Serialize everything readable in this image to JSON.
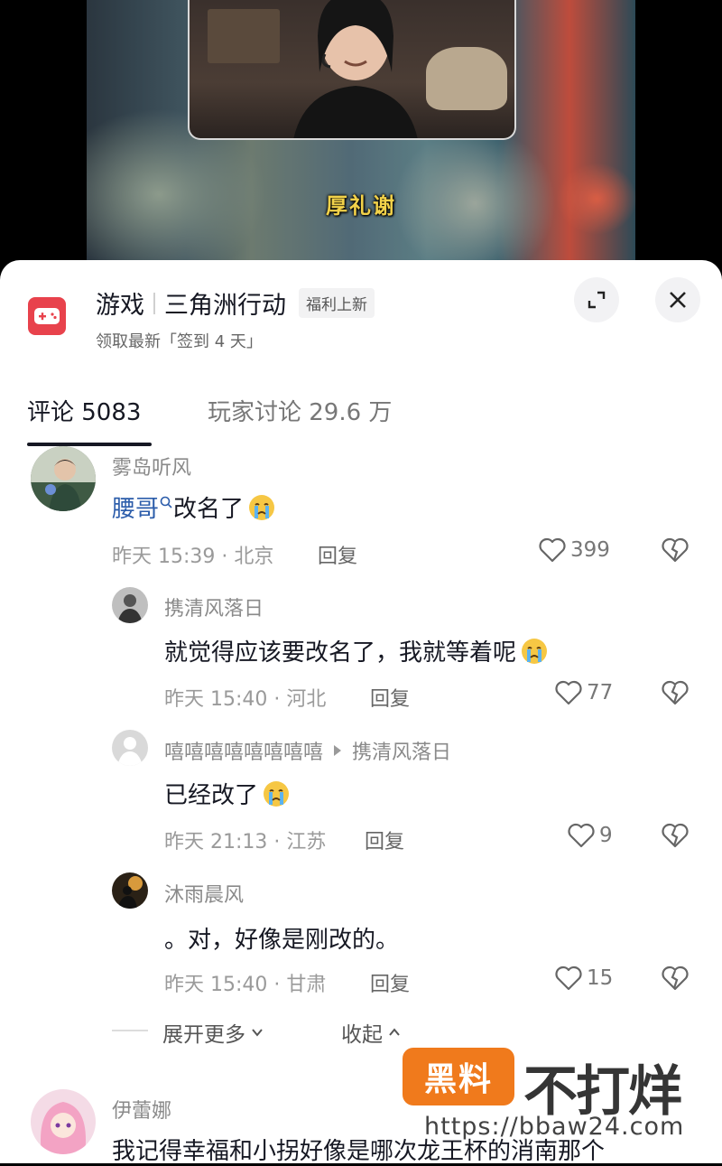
{
  "video": {
    "subtitle": "厚礼谢"
  },
  "game_header": {
    "category": "游戏",
    "game_name": "三角洲行动",
    "badge": "福利上新",
    "subline": "领取最新「签到 4 天」"
  },
  "tabs": [
    {
      "label": "评论 5083",
      "active": true
    },
    {
      "label": "玩家讨论 29.6 万",
      "active": false
    }
  ],
  "comments": [
    {
      "user": "雾岛听风",
      "text_link": "腰哥",
      "text": "改名了",
      "emoji": "crying-emoji",
      "time_location": "昨天 15:39 · 北京",
      "reply_label": "回复",
      "likes": "399"
    },
    {
      "user": "携清风落日",
      "text": "就觉得应该要改名了，我就等着呢",
      "emoji": "crying-emoji",
      "time_location": "昨天 15:40 · 河北",
      "reply_label": "回复",
      "likes": "77"
    },
    {
      "user": "嘻嘻嘻嘻嘻嘻嘻嘻",
      "reply_to": "携清风落日",
      "text": "已经改了",
      "emoji": "crying-emoji",
      "time_location": "昨天 21:13 · 江苏",
      "reply_label": "回复",
      "likes": "9"
    },
    {
      "user": "沐雨晨风",
      "text": "。对，好像是刚改的。",
      "time_location": "昨天 15:40 · 甘肃",
      "reply_label": "回复",
      "likes": "15"
    },
    {
      "user": "伊蕾娜",
      "text": "我记得幸福和小拐好像是哪次龙王杯的消南那个"
    }
  ],
  "expand": {
    "more": "展开更多",
    "collapse": "收起"
  },
  "watermark": {
    "logo": "黑料",
    "text": "不打烊",
    "url": "https://bbaw24.com"
  }
}
